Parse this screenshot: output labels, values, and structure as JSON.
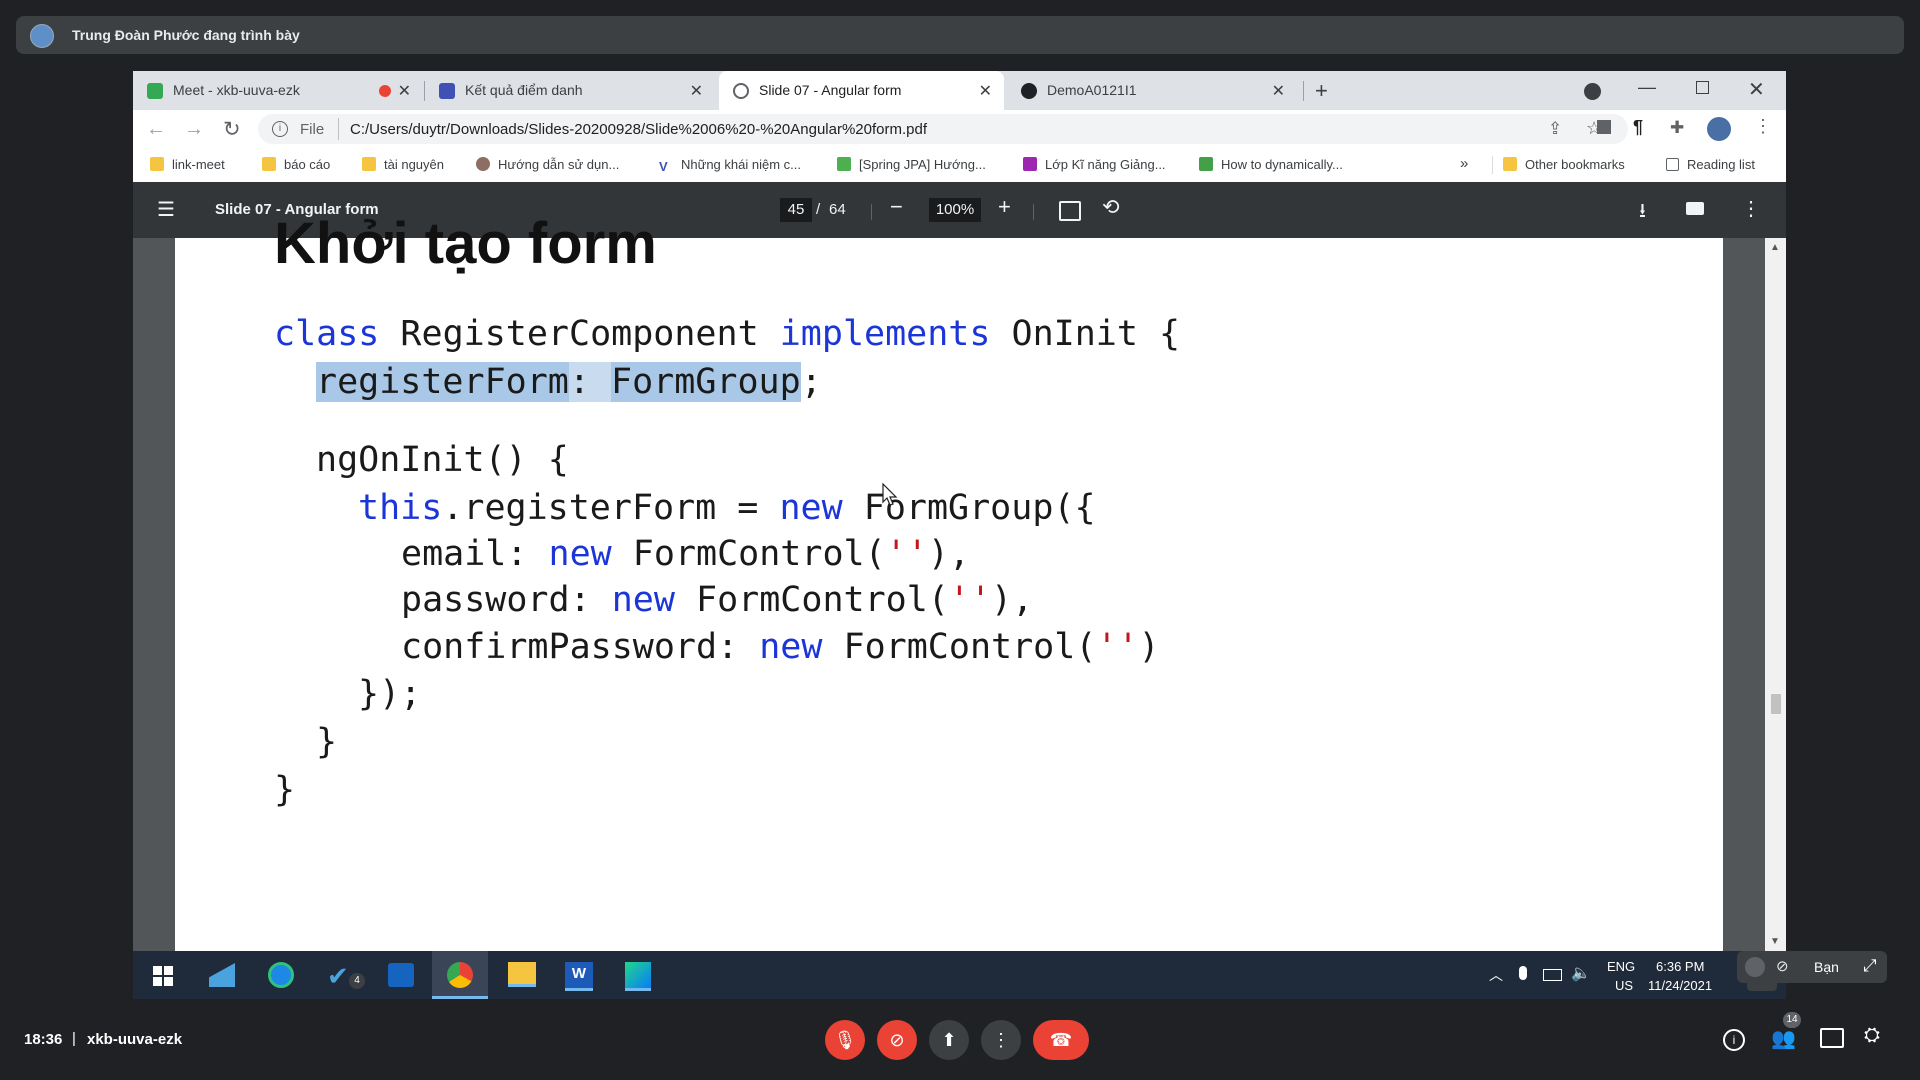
{
  "presenter": {
    "text": "Trung Đoàn Phước đang trình bày"
  },
  "tabs": [
    {
      "label": "Meet - xkb-uuva-ezk",
      "color": "#34a853"
    },
    {
      "label": "Kết quả điểm danh",
      "color": "#3f51b5"
    },
    {
      "label": "Slide 07 - Angular form",
      "color": "#5f6368"
    },
    {
      "label": "DemoA0121I1",
      "color": "#202124"
    }
  ],
  "address": {
    "scheme": "File",
    "url": "C:/Users/duytr/Downloads/Slides-20200928/Slide%2006%20-%20Angular%20form.pdf"
  },
  "bookmarks": [
    "link-meet",
    "báo cáo",
    "tài nguyên",
    "Hướng dẫn sử dụn...",
    "Những khái niệm c...",
    "[Spring JPA] Hướng...",
    "Lớp Kĩ năng Giảng...",
    "How to dynamically...",
    "»",
    "Other bookmarks",
    "Reading list"
  ],
  "pdf": {
    "title": "Slide 07 - Angular form",
    "page": "45",
    "sep": "/",
    "total": "64",
    "zoom": "100%"
  },
  "slide": {
    "heading": "Khởi tạo form",
    "code": {
      "l1_kw1": "class",
      "l1_a": " RegisterComponent ",
      "l1_kw2": "implements",
      "l1_b": " OnInit {",
      "l2_a": "registerForm",
      "l2_b": ": ",
      "l2_c": "FormGroup",
      "l2_d": ";",
      "l3": "ngOnInit() {",
      "l4_kw": "this",
      "l4_a": ".registerForm = ",
      "l4_kw2": "new",
      "l4_b": " FormGroup({",
      "l5_a": "email: ",
      "l5_kw": "new",
      "l5_b": " FormControl(",
      "l5_s": "''",
      "l5_c": "),",
      "l6_a": "password: ",
      "l6_kw": "new",
      "l6_b": " FormControl(",
      "l6_s": "''",
      "l6_c": "),",
      "l7_a": "confirmPassword: ",
      "l7_kw": "new",
      "l7_b": " FormControl(",
      "l7_s": "''",
      "l7_c": ")",
      "l8": "});",
      "l9": "}",
      "l10": "}"
    }
  },
  "taskbar": {
    "badge": "4",
    "lang1": "ENG",
    "lang2": "US",
    "time": "6:36 PM",
    "date": "11/24/2021",
    "you_label": "Bạn"
  },
  "meet": {
    "clock": "18:36",
    "sep": "|",
    "code": "xkb-uuva-ezk",
    "people_count": "14"
  }
}
